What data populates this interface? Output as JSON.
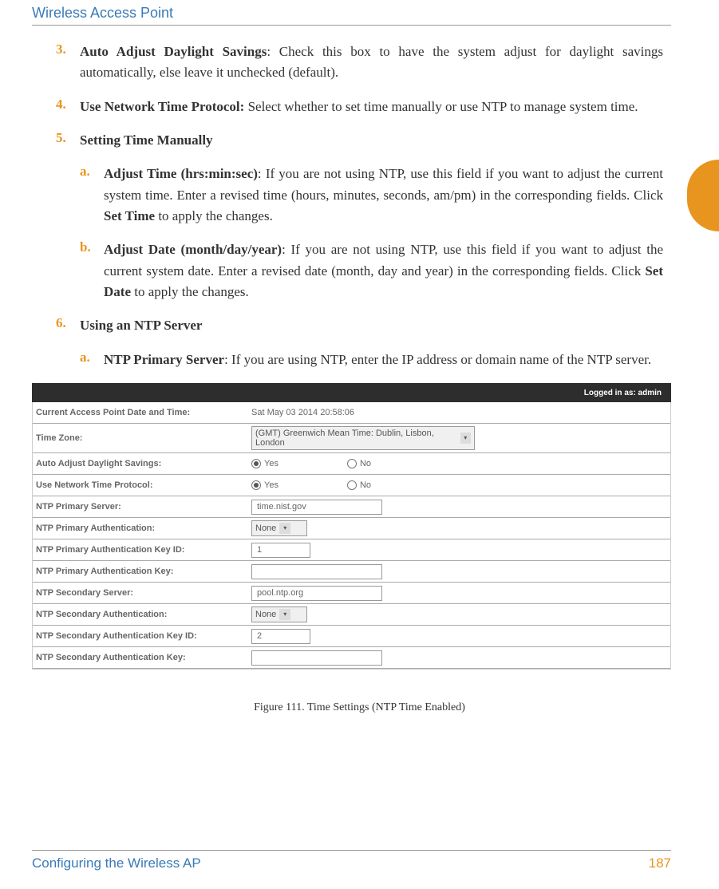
{
  "header": "Wireless Access Point",
  "items": [
    {
      "num": "3.",
      "bold": "Auto Adjust Daylight Savings",
      "text": ": Check this box to have the system adjust for daylight savings automatically, else leave it unchecked (default)."
    },
    {
      "num": "4.",
      "bold": "Use Network Time Protocol:",
      "text": " Select whether to set time manually or use NTP to manage system time."
    },
    {
      "num": "5.",
      "bold": "Setting Time Manually",
      "text": "",
      "subs": [
        {
          "letter": "a.",
          "bold": "Adjust Time (hrs:min:sec)",
          "text1": ": If you are not using NTP, use this field if you want to adjust the current system time. Enter a revised time (hours, minutes, seconds, am/pm) in the corresponding fields. Click ",
          "bold2": "Set Time",
          "text2": " to apply the changes."
        },
        {
          "letter": "b.",
          "bold": "Adjust Date (month/day/year)",
          "text1": ": If you are not using NTP, use this field if you want to adjust the current system date. Enter a revised date (month, day and year) in the corresponding fields. Click ",
          "bold2": "Set Date",
          "text2": " to apply the changes."
        }
      ]
    },
    {
      "num": "6.",
      "bold": "Using an NTP Server",
      "text": "",
      "subs": [
        {
          "letter": "a.",
          "bold": "NTP Primary Server",
          "text1": ": If you are using NTP, enter the IP address or domain name of the NTP server.",
          "bold2": "",
          "text2": ""
        }
      ]
    }
  ],
  "screenshot": {
    "logged_in": "Logged in as: admin",
    "rows": [
      {
        "label": "Current Access Point Date and Time:",
        "type": "text",
        "value": "Sat May 03 2014 20:58:06"
      },
      {
        "label": "Time Zone:",
        "type": "select",
        "value": "(GMT) Greenwich Mean Time: Dublin, Lisbon, London"
      },
      {
        "label": "Auto Adjust Daylight Savings:",
        "type": "radio",
        "yes": "Yes",
        "no": "No",
        "selected": "yes"
      },
      {
        "label": "Use Network Time Protocol:",
        "type": "radio",
        "yes": "Yes",
        "no": "No",
        "selected": "yes"
      },
      {
        "label": "NTP Primary Server:",
        "type": "input",
        "value": "time.nist.gov"
      },
      {
        "label": "NTP Primary Authentication:",
        "type": "select-sm",
        "value": "None"
      },
      {
        "label": "NTP Primary Authentication Key ID:",
        "type": "input-sm",
        "value": "1"
      },
      {
        "label": "NTP Primary Authentication Key:",
        "type": "input",
        "value": ""
      },
      {
        "label": "NTP Secondary Server:",
        "type": "input",
        "value": "pool.ntp.org"
      },
      {
        "label": "NTP Secondary Authentication:",
        "type": "select-sm",
        "value": "None"
      },
      {
        "label": "NTP Secondary Authentication Key ID:",
        "type": "input-sm",
        "value": "2"
      },
      {
        "label": "NTP Secondary Authentication Key:",
        "type": "input",
        "value": ""
      }
    ]
  },
  "figure_caption": "Figure 111. Time Settings (NTP Time Enabled)",
  "footer": {
    "left": "Configuring the Wireless AP",
    "right": "187"
  }
}
